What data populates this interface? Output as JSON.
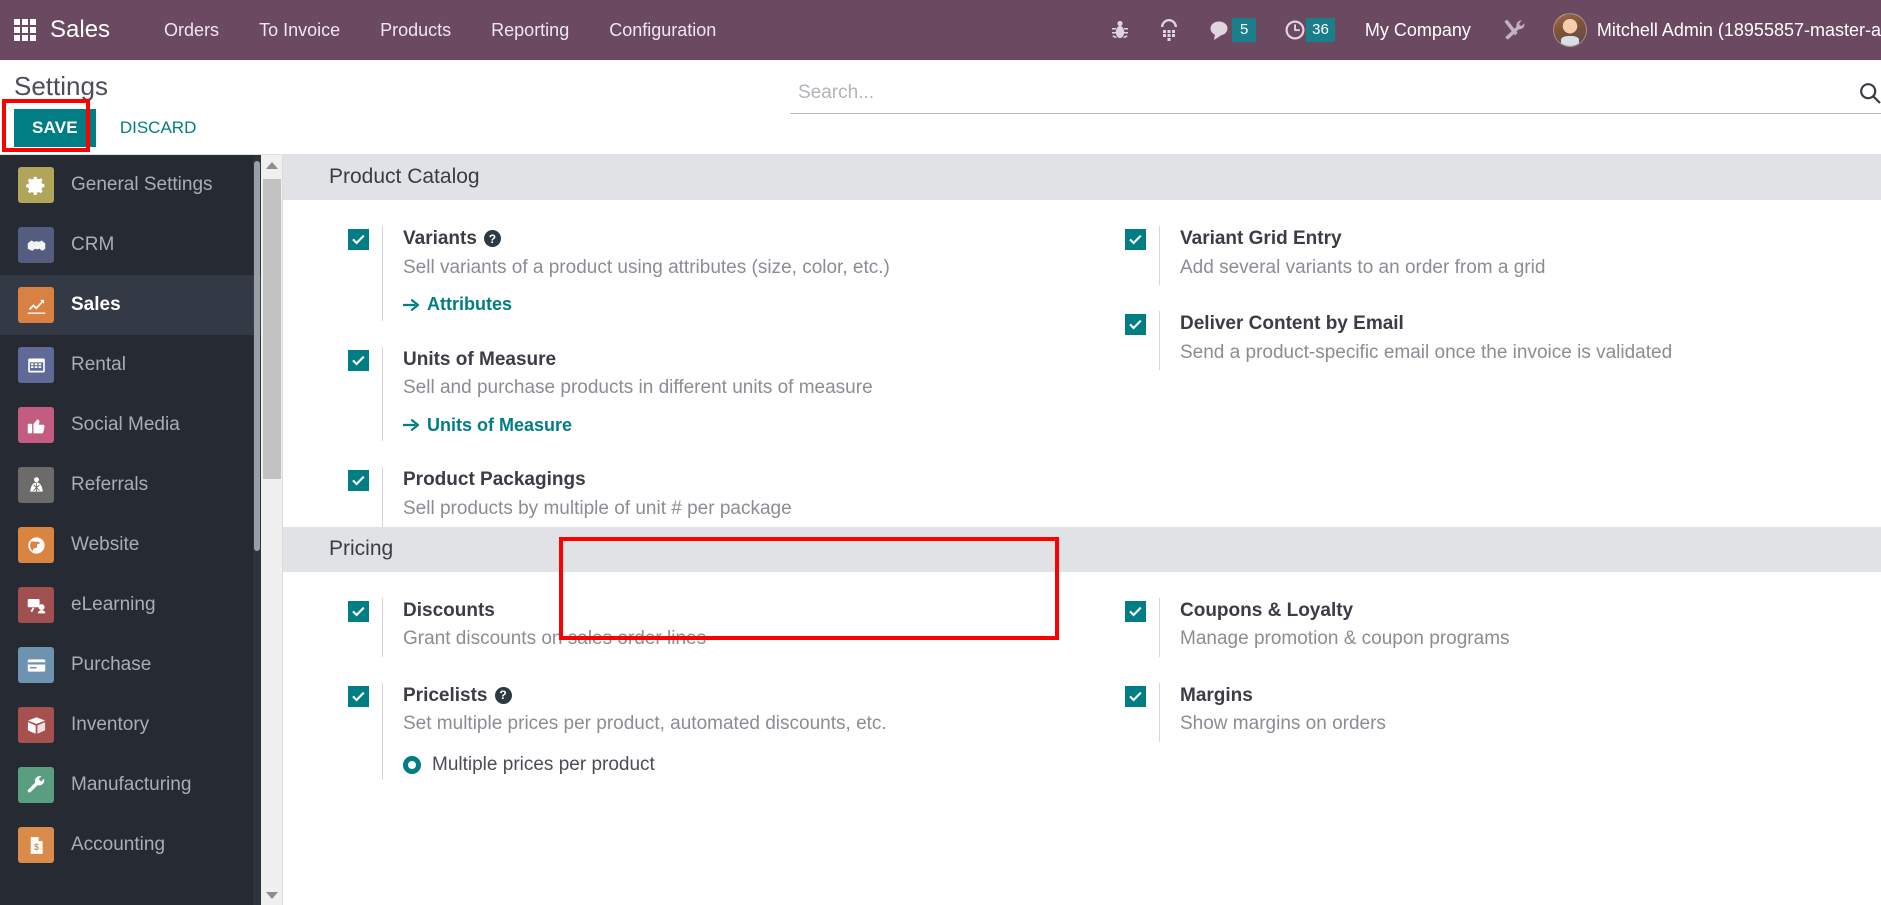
{
  "navbar": {
    "apps_icon": "apps-grid-icon",
    "brand": "Sales",
    "menus": [
      "Orders",
      "To Invoice",
      "Products",
      "Reporting",
      "Configuration"
    ],
    "icons": [
      {
        "name": "bug-icon",
        "label": ""
      },
      {
        "name": "phone-dialpad-icon",
        "label": ""
      }
    ],
    "messages": {
      "icon": "chat-bubble-icon",
      "count": "5"
    },
    "activities": {
      "icon": "clock-icon",
      "count": "36"
    },
    "company": "My Company",
    "tools_icon": "tools-icon",
    "user": "Mitchell Admin (18955857-master-a",
    "accent_badge_color": "#1a7e8b",
    "bar_color": "#6b4961"
  },
  "control_panel": {
    "title": "Settings",
    "save_label": "SAVE",
    "discard_label": "DISCARD",
    "save_color": "#017e84",
    "highlight_color": "#ff0000"
  },
  "search": {
    "placeholder": "Search...",
    "value": "",
    "icon": "search-icon"
  },
  "sidebar": {
    "items": [
      {
        "label": "General Settings",
        "icon": "gear-icon",
        "color": "#b0a559",
        "active": false
      },
      {
        "label": "CRM",
        "icon": "handshake-icon",
        "color": "#545d80",
        "active": false
      },
      {
        "label": "Sales",
        "icon": "chart-line-icon",
        "color": "#d98143",
        "active": true
      },
      {
        "label": "Rental",
        "icon": "calendar-icon",
        "color": "#5f6b96",
        "active": false
      },
      {
        "label": "Social Media",
        "icon": "thumbs-up-icon",
        "color": "#c45b81",
        "active": false
      },
      {
        "label": "Referrals",
        "icon": "gift-person-icon",
        "color": "#6d6b69",
        "active": false
      },
      {
        "label": "Website",
        "icon": "globe-icon",
        "color": "#d9853f",
        "active": false
      },
      {
        "label": "eLearning",
        "icon": "presentation-icon",
        "color": "#a15050",
        "active": false
      },
      {
        "label": "Purchase",
        "icon": "credit-card-icon",
        "color": "#6e93b0",
        "active": false
      },
      {
        "label": "Inventory",
        "icon": "box-icon",
        "color": "#a75050",
        "active": false
      },
      {
        "label": "Manufacturing",
        "icon": "wrench-icon",
        "color": "#5a9e80",
        "active": false
      },
      {
        "label": "Accounting",
        "icon": "invoice-dollar-icon",
        "color": "#d98b4a",
        "active": false
      }
    ]
  },
  "sections": [
    {
      "title": "Product Catalog",
      "left": [
        {
          "label": "Variants",
          "desc": "Sell variants of a product using attributes (size, color, etc.)",
          "checked": true,
          "help": true,
          "link": "Attributes",
          "highlight": false
        },
        {
          "label": "Units of Measure",
          "desc": "Sell and purchase products in different units of measure",
          "checked": true,
          "help": false,
          "link": "Units of Measure",
          "highlight": true
        },
        {
          "label": "Product Packagings",
          "desc": "Sell products by multiple of unit # per package",
          "checked": true,
          "help": false,
          "link": "",
          "highlight": false
        }
      ],
      "right": [
        {
          "label": "Variant Grid Entry",
          "desc": "Add several variants to an order from a grid",
          "checked": true,
          "help": false,
          "link": "",
          "highlight": false
        },
        {
          "label": "Deliver Content by Email",
          "desc": "Send a product-specific email once the invoice is validated",
          "checked": true,
          "help": false,
          "link": "",
          "highlight": false
        }
      ]
    },
    {
      "title": "Pricing",
      "left": [
        {
          "label": "Discounts",
          "desc": "Grant discounts on sales order lines",
          "checked": true,
          "help": false,
          "link": "",
          "highlight": false
        },
        {
          "label": "Pricelists",
          "desc": "Set multiple prices per product, automated discounts, etc.",
          "checked": true,
          "help": true,
          "link": "",
          "radio": "Multiple prices per product",
          "highlight": false
        }
      ],
      "right": [
        {
          "label": "Coupons & Loyalty",
          "desc": "Manage promotion & coupon programs",
          "checked": true,
          "help": false,
          "link": "",
          "highlight": false
        },
        {
          "label": "Margins",
          "desc": "Show margins on orders",
          "checked": true,
          "help": false,
          "link": "",
          "highlight": false
        }
      ]
    }
  ]
}
